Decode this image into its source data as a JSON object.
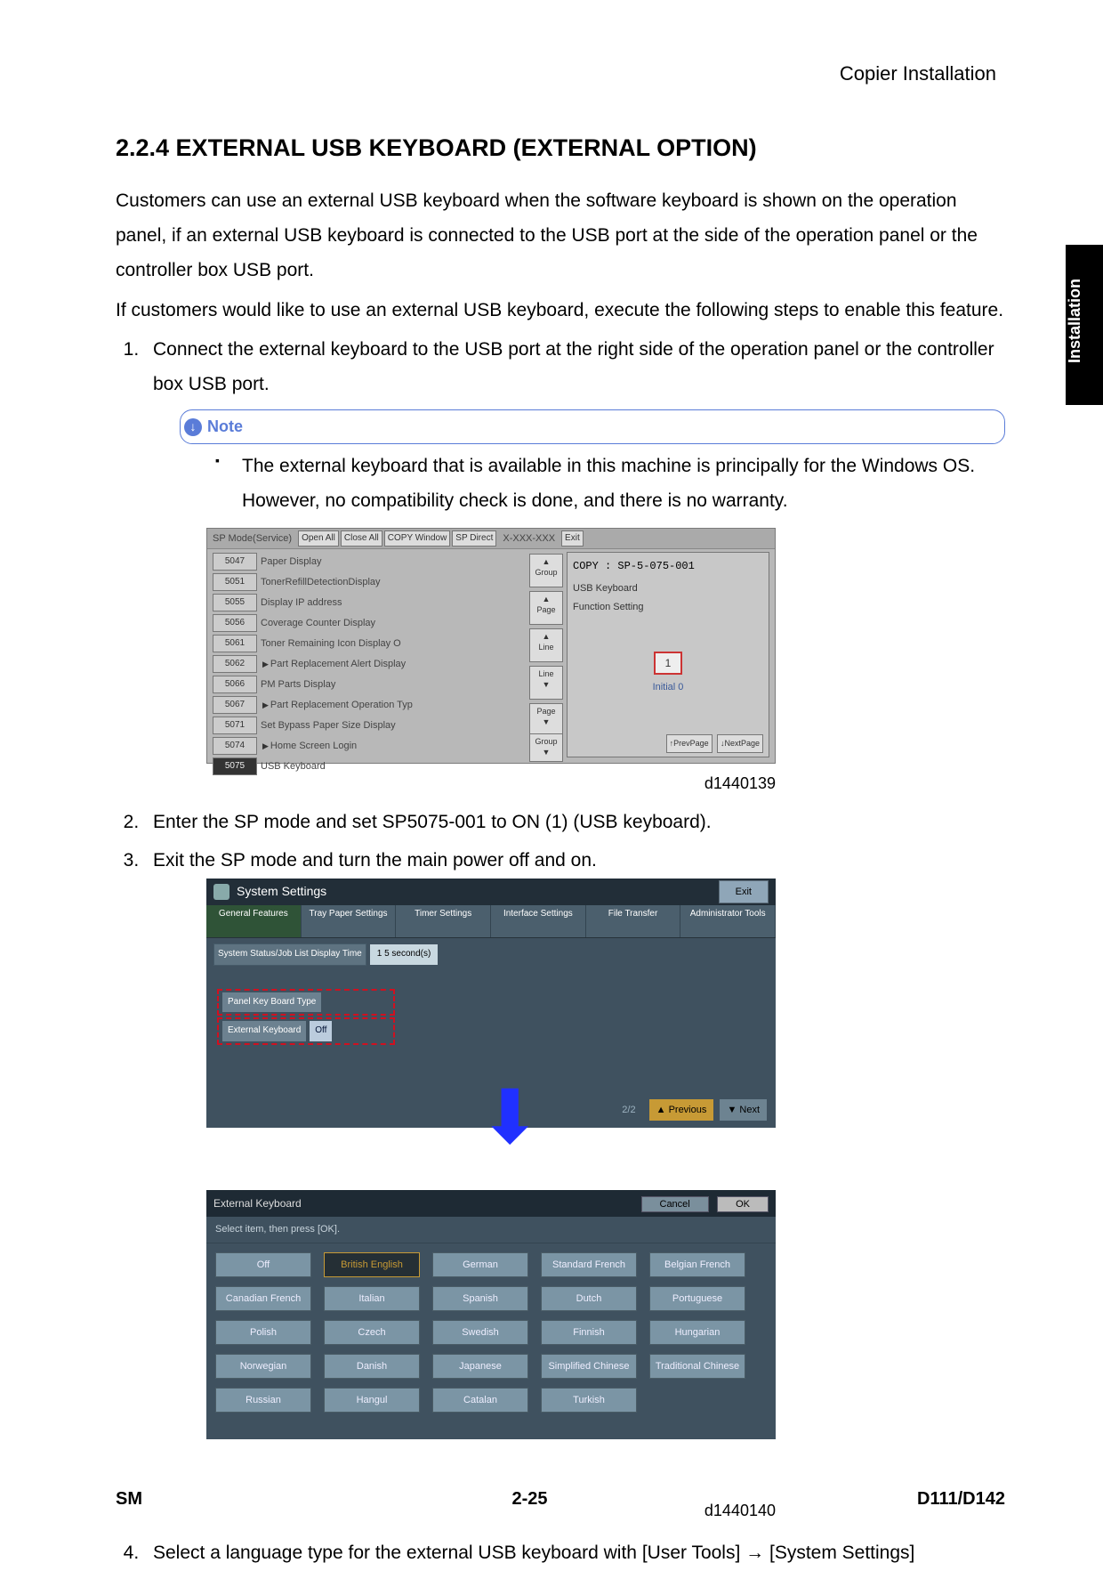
{
  "page": {
    "header": "Copier Installation",
    "side_tab": "Installation",
    "footer_left": "SM",
    "footer_center": "2-25",
    "footer_right": "D111/D142"
  },
  "section": {
    "number_title": "2.2.4  EXTERNAL USB KEYBOARD (EXTERNAL OPTION)"
  },
  "intro": {
    "p1": "Customers can use an external USB keyboard when the software keyboard is shown on the operation panel, if an external USB keyboard is connected to the USB port at the side of the operation panel or the controller box USB port.",
    "p2": "If customers would like to use an external USB keyboard, execute the following steps to enable this feature."
  },
  "steps": {
    "s1": "Connect the external keyboard to the USB port at the right side of the operation panel or the controller box USB port.",
    "note_label": "Note",
    "note_bullet": "The external keyboard that is available in this machine is principally for the Windows OS. However, no compatibility check is done, and there is no warranty.",
    "s2": "Enter the SP mode and set SP5075-001 to ON (1) (USB keyboard).",
    "s3": "Exit the SP mode and turn the main power off and on.",
    "s4": "Select a language type for the external USB keyboard with [User Tools]  →  [System Settings]"
  },
  "shot1": {
    "title": "SP Mode(Service)",
    "btns": [
      "Open All",
      "Close All",
      "COPY Window",
      "SP Direct"
    ],
    "code": "X-XXX-XXX",
    "exit": "Exit",
    "items": [
      {
        "num": "5047",
        "txt": "Paper Display"
      },
      {
        "num": "5051",
        "txt": "TonerRefillDetectionDisplay"
      },
      {
        "num": "5055",
        "txt": "Display IP address"
      },
      {
        "num": "5056",
        "txt": "Coverage Counter Display"
      },
      {
        "num": "5061",
        "txt": "Toner Remaining Icon Display O"
      },
      {
        "num": "5062",
        "txt": "Part Replacement Alert Display",
        "tri": true
      },
      {
        "num": "5066",
        "txt": "PM Parts Display"
      },
      {
        "num": "5067",
        "txt": "Part Replacement Operation Typ",
        "tri": true
      },
      {
        "num": "5071",
        "txt": "Set Bypass Paper Size Display"
      },
      {
        "num": "5074",
        "txt": "Home Screen Login",
        "tri": true
      },
      {
        "num": "5075",
        "txt": "USB Keyboard",
        "sel": true
      }
    ],
    "nav": {
      "group": "Group",
      "page": "Page",
      "line": "Line"
    },
    "right_title": "COPY : SP-5-075-001",
    "right_sub1": "USB Keyboard",
    "right_sub2": "Function Setting",
    "one": "1",
    "initial": "Initial  0",
    "prev": "↑PrevPage",
    "next": "↓NextPage",
    "caption": "d1440139"
  },
  "shot2": {
    "sys_title": "System Settings",
    "exit": "Exit",
    "tabs": [
      "General Features",
      "Tray Paper Settings",
      "Timer Settings",
      "Interface Settings",
      "File Transfer",
      "Administrator Tools"
    ],
    "status_btn": "System Status/Job List Display Time",
    "status_val": "1 5 second(s)",
    "hl1": "Panel Key Board Type",
    "hl2": "External Keyboard",
    "hl2v": "Off",
    "pg": "2/2",
    "prev": "▲ Previous",
    "next": "▼ Next",
    "kbd_title": "External Keyboard",
    "cancel": "Cancel",
    "ok": "OK",
    "hint": "Select item, then press [OK].",
    "langs": [
      [
        "Off",
        "British English",
        "German",
        "Standard French",
        "Belgian French"
      ],
      [
        "Canadian French",
        "Italian",
        "Spanish",
        "Dutch",
        "Portuguese"
      ],
      [
        "Polish",
        "Czech",
        "Swedish",
        "Finnish",
        "Hungarian"
      ],
      [
        "Norwegian",
        "Danish",
        "Japanese",
        "Simplified Chinese",
        "Traditional Chinese"
      ],
      [
        "Russian",
        "Hangul",
        "Catalan",
        "Turkish",
        ""
      ]
    ],
    "selected": "British English",
    "caption": "d1440140"
  }
}
